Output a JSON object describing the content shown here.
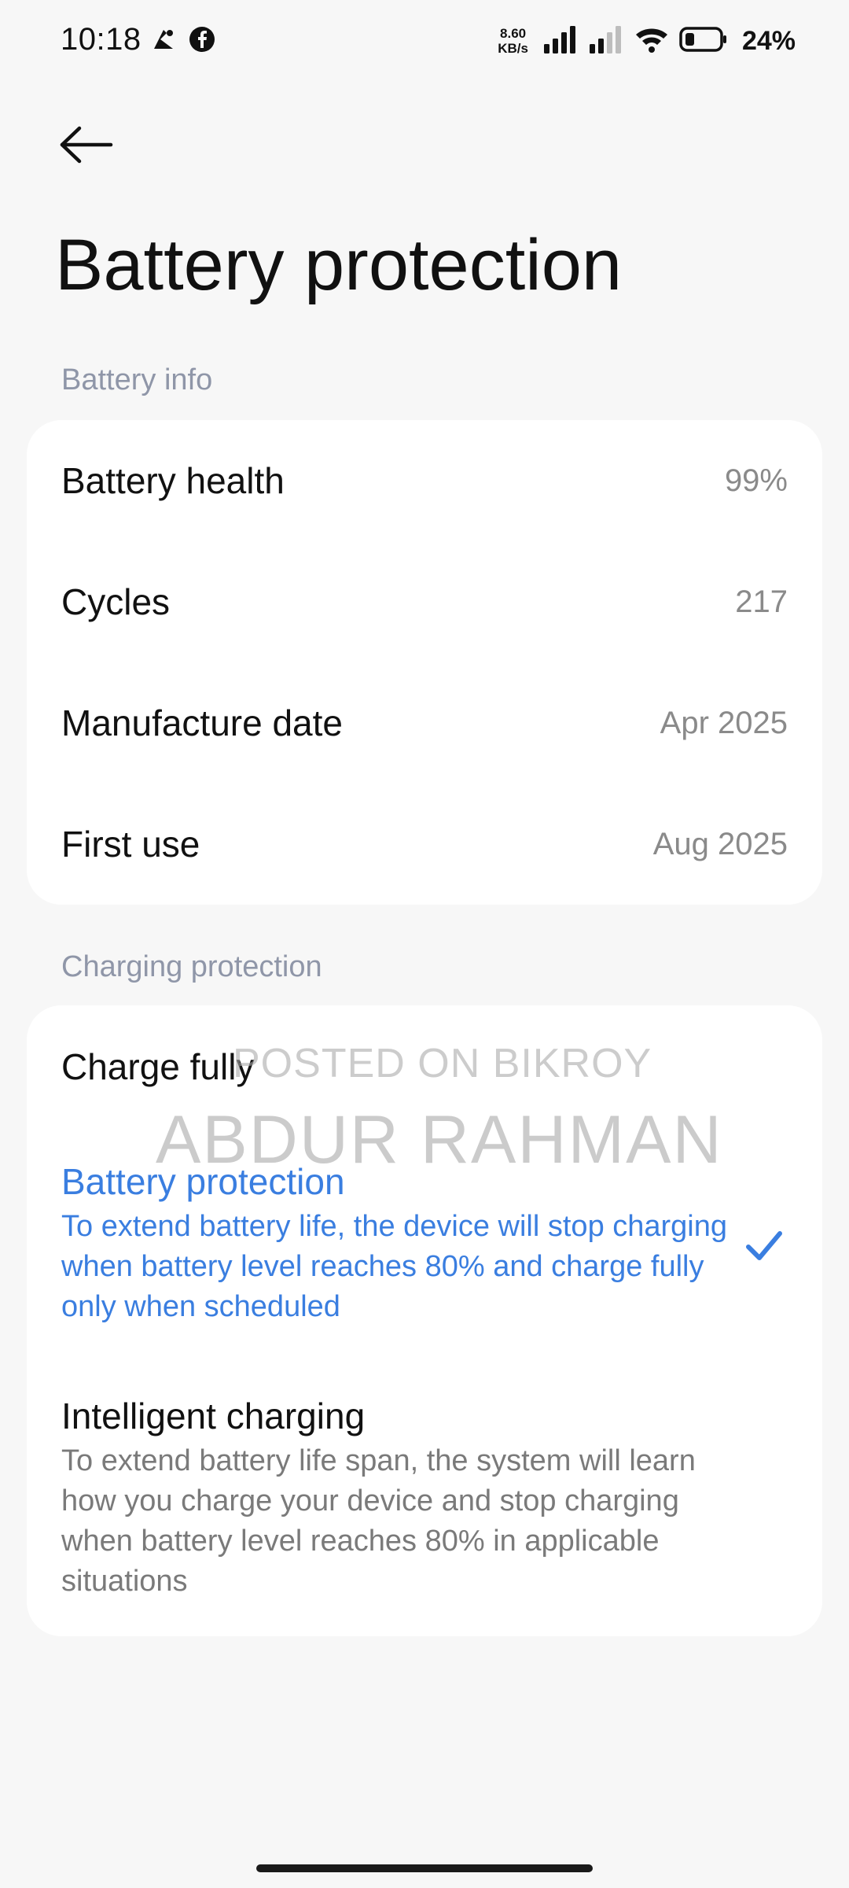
{
  "status_bar": {
    "time": "10:18",
    "net_speed_value": "8.60",
    "net_speed_unit": "KB/s",
    "battery_percent": "24%",
    "icons": [
      "call-icon",
      "facebook-icon",
      "signal-icon",
      "signal-weak-icon",
      "wifi-icon",
      "battery-icon"
    ]
  },
  "header": {
    "back_icon": "arrow-left-icon",
    "title": "Battery protection"
  },
  "battery_info": {
    "section_label": "Battery info",
    "rows": [
      {
        "label": "Battery health",
        "value": "99%"
      },
      {
        "label": "Cycles",
        "value": "217"
      },
      {
        "label": "Manufacture date",
        "value": "Apr 2025"
      },
      {
        "label": "First use",
        "value": "Aug 2025"
      }
    ]
  },
  "charging_protection": {
    "section_label": "Charging protection",
    "options": [
      {
        "title": "Charge fully",
        "description": "",
        "selected": false
      },
      {
        "title": "Battery protection",
        "description": "To extend battery life, the device will stop charging when battery level reaches 80% and charge fully only when scheduled",
        "selected": true
      },
      {
        "title": "Intelligent charging",
        "description": "To extend battery life span, the system will learn how you charge your device and stop charging when battery level reaches 80% in applicable situations",
        "selected": false
      }
    ],
    "selected_color": "#3a7ee0"
  },
  "watermark": {
    "line1": "POSTED ON BIKROY",
    "line2": "ABDUR RAHMAN"
  }
}
